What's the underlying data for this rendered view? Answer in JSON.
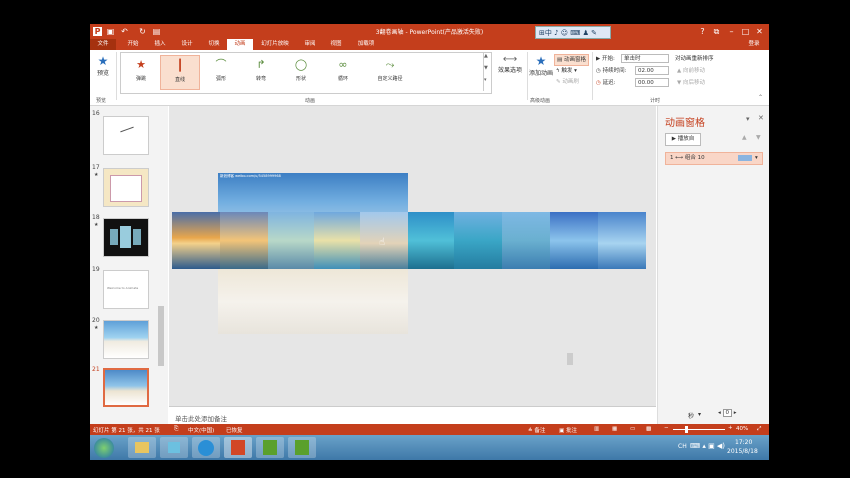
{
  "window": {
    "title": "3翻卷画轴 - PowerPoint(产品激活失败)",
    "help": "?",
    "login": "登录"
  },
  "tabs": [
    "文件",
    "开始",
    "插入",
    "设计",
    "切换",
    "动画",
    "幻灯片放映",
    "审阅",
    "视图",
    "加载项"
  ],
  "active_tab": "动画",
  "ribbon": {
    "preview": {
      "label": "预览",
      "group": "预览"
    },
    "animations": [
      {
        "label": "弹跳",
        "icon": "star-icon"
      },
      {
        "label": "直线",
        "icon": "line-path-icon"
      },
      {
        "label": "弧形",
        "icon": "arc-icon"
      },
      {
        "label": "转弯",
        "icon": "turn-icon"
      },
      {
        "label": "形状",
        "icon": "circle-icon"
      },
      {
        "label": "循环",
        "icon": "loop-icon"
      },
      {
        "label": "自定义路径",
        "icon": "custom-path-icon"
      }
    ],
    "animation_group": "动画",
    "effect_options": "效果选项",
    "add_animation": "添加动画",
    "animation_pane_btn": "动画窗格",
    "trigger": "触发",
    "animation_painter": "动画刷",
    "advanced_group": "高级动画",
    "start_label": "开始:",
    "start_value": "单击时",
    "duration_label": "持续时间:",
    "duration_value": "02.00",
    "delay_label": "延迟:",
    "delay_value": "00.00",
    "reorder_title": "对动画重新排序",
    "move_earlier": "向前移动",
    "move_later": "向后移动",
    "timing_group": "计时"
  },
  "slides": [
    {
      "num": "16",
      "star": ""
    },
    {
      "num": "17",
      "star": "★"
    },
    {
      "num": "18",
      "star": "★"
    },
    {
      "num": "19",
      "star": ""
    },
    {
      "num": "20",
      "star": "★"
    },
    {
      "num": "21",
      "star": ""
    }
  ],
  "slide19_text": "Welcome to Animate",
  "canvas": {
    "watermark": "新浪博客 weibo.com/u/5458999968"
  },
  "notes_placeholder": "单击此处添加备注",
  "pane": {
    "title": "动画窗格",
    "play_button": "播放自",
    "item": "1 ⟷ 组合 10",
    "seconds": "秒",
    "page_value": "0"
  },
  "status": {
    "slide_info": "幻灯片 第 21 张，共 21 张",
    "lang": "中文(中国)",
    "recovered": "已恢复",
    "notes": "备注",
    "comments": "批注",
    "zoom": "40%"
  },
  "taskbar": {
    "time": "17:20",
    "date": "2015/8/18",
    "ime": "CH"
  },
  "colors": {
    "accent": "#c43e1c",
    "pane_item": "#f9d6c7"
  }
}
